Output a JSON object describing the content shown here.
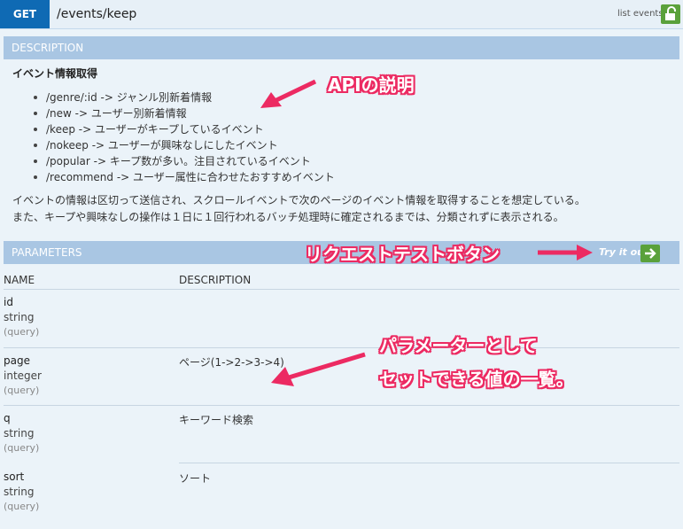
{
  "endpoint": {
    "method": "GET",
    "path": "/events/keep",
    "list_events_label": "list events",
    "lock_icon": "unlock-icon"
  },
  "description": {
    "header": "DESCRIPTION",
    "title": "イベント情報取得",
    "items": [
      "/genre/:id -> ジャンル別新着情報",
      "/new -> ユーザー別新着情報",
      "/keep -> ユーザーがキープしているイベント",
      "/nokeep -> ユーザーが興味なしにしたイベント",
      "/popular -> キープ数が多い。注目されているイベント",
      "/recommend -> ユーザー属性に合わせたおすすめイベント"
    ],
    "paragraph": [
      "イベントの情報は区切って送信され、スクロールイベントで次のページのイベント情報を取得することを想定している。",
      "また、キープや興味なしの操作は１日に１回行われるバッチ処理時に確定されるまでは、分類されずに表示される。"
    ]
  },
  "parameters": {
    "header": "PARAMETERS",
    "try_it_out": "Try it out",
    "col_name": "NAME",
    "col_description": "DESCRIPTION",
    "rows": [
      {
        "name": "id",
        "type": "string",
        "in": "(query)",
        "description": ""
      },
      {
        "name": "page",
        "type": "integer",
        "in": "(query)",
        "description": "ページ(1->2->3->4)"
      },
      {
        "name": "q",
        "type": "string",
        "in": "(query)",
        "description": "キーワード検索"
      },
      {
        "name": "sort",
        "type": "string",
        "in": "(query)",
        "description": "ソート"
      }
    ]
  },
  "annotations": {
    "api_desc": "APIの説明",
    "request_test": "リクエストテストボタン",
    "params_line1": "パラメーターとして",
    "params_line2": "セットできる値の一覧。",
    "color": "#ec2a62"
  },
  "colors": {
    "get_badge": "#0f6ab4",
    "section_header": "#a9c6e3",
    "button_green": "#5aa13b",
    "annotation_pink": "#ec2a62"
  }
}
